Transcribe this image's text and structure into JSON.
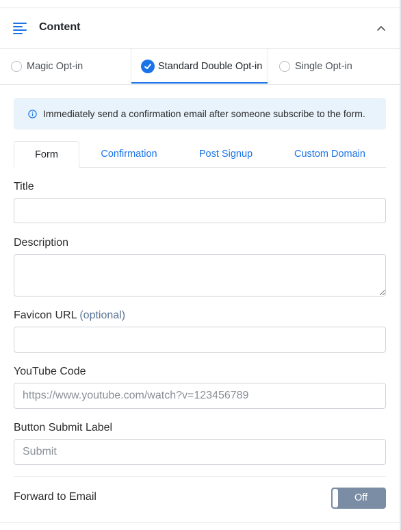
{
  "section": {
    "title": "Content"
  },
  "optin_options": [
    {
      "label": "Magic Opt-in",
      "selected": false
    },
    {
      "label": "Standard Double Opt-in",
      "selected": true
    },
    {
      "label": "Single Opt-in",
      "selected": false
    }
  ],
  "info": {
    "text": "Immediately send a confirmation email after someone subscribe to the form."
  },
  "tabs": [
    {
      "label": "Form",
      "active": true
    },
    {
      "label": "Confirmation",
      "active": false
    },
    {
      "label": "Post Signup",
      "active": false
    },
    {
      "label": "Custom Domain",
      "active": false
    }
  ],
  "form": {
    "title_label": "Title",
    "title_value": "",
    "description_label": "Description",
    "description_value": "",
    "favicon_label": "Favicon URL",
    "favicon_optional": "(optional)",
    "favicon_value": "",
    "youtube_label": "YouTube Code",
    "youtube_placeholder": "https://www.youtube.com/watch?v=123456789",
    "submit_label_label": "Button Submit Label",
    "submit_label_placeholder": "Submit",
    "forward_label": "Forward to Email",
    "forward_toggle_text": "Off",
    "forward_enabled": false
  },
  "colors": {
    "accent": "#1a73e8",
    "toggle_off": "#7b8da4",
    "info_bg": "#e9f3fb"
  }
}
